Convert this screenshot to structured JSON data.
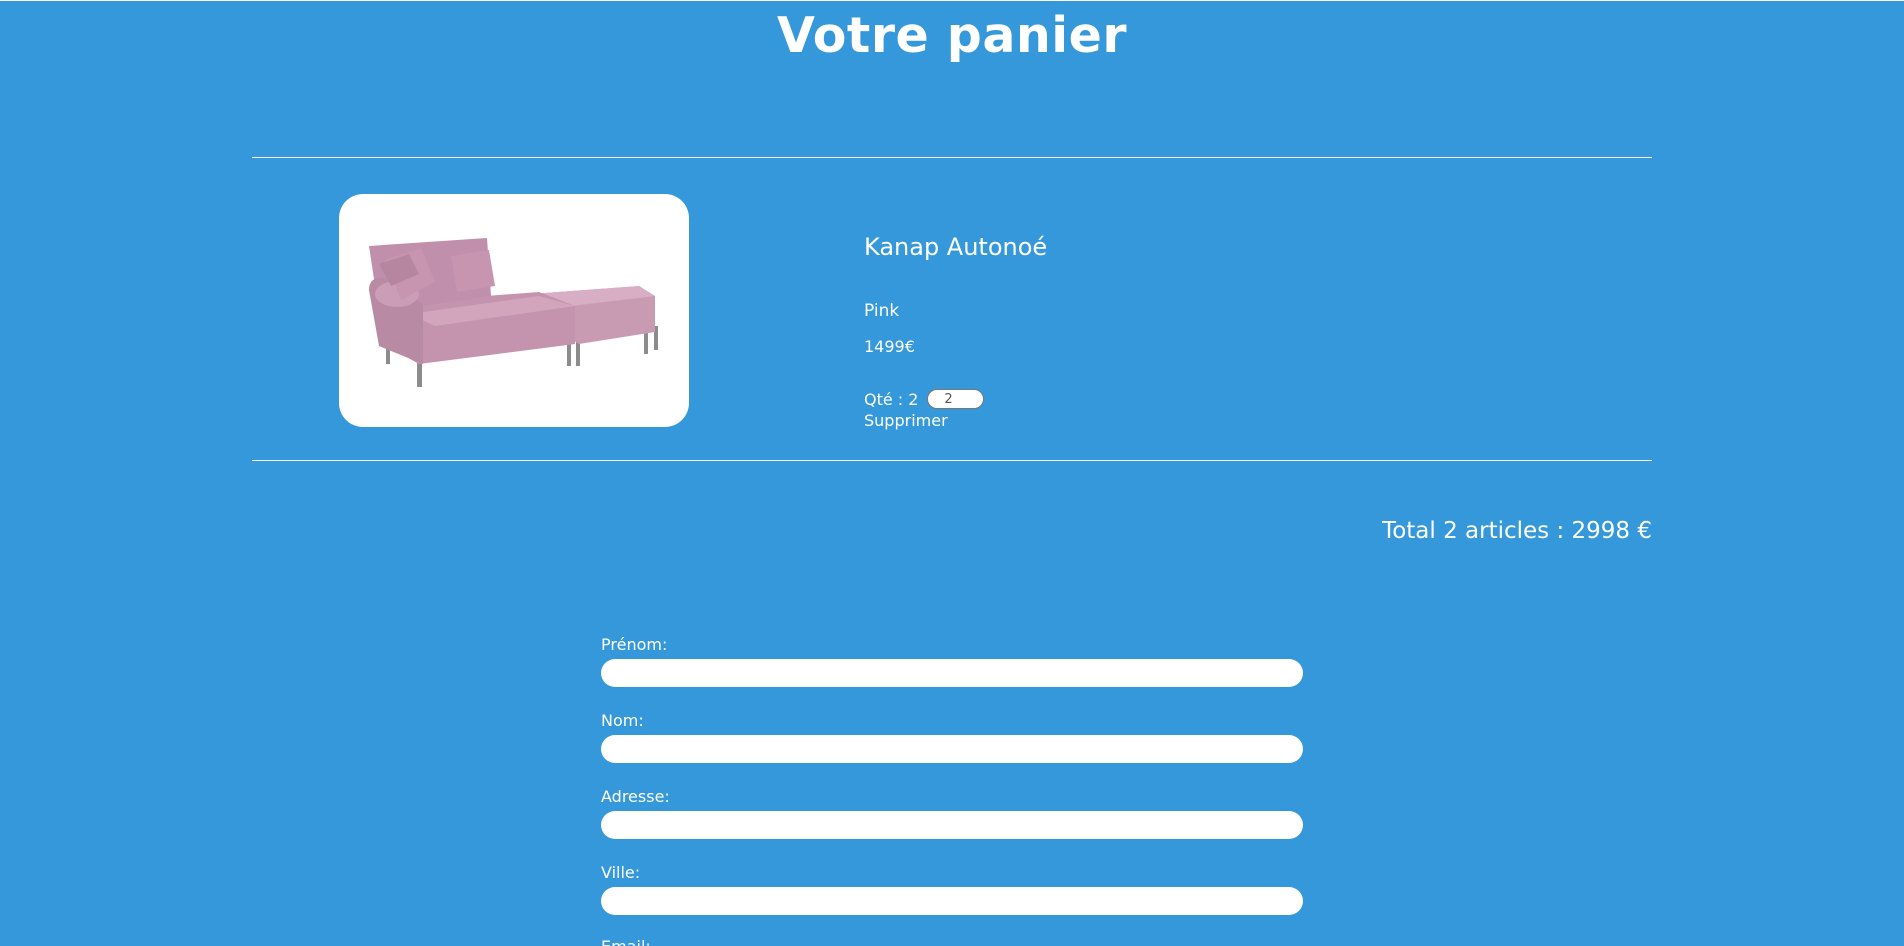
{
  "page": {
    "title": "Votre panier",
    "background_color": "#3498db"
  },
  "cart": {
    "items": [
      {
        "image_icon": "pink-sofa-image",
        "name": "Kanap Autonoé",
        "color": "Pink",
        "price": "1499€",
        "quantity_label": "Qté : 2",
        "quantity_value": "2",
        "delete_label": "Supprimer"
      }
    ],
    "total_label": "Total 2 articles : 2998 €"
  },
  "form": {
    "first_name_label": "Prénom:",
    "last_name_label": "Nom:",
    "address_label": "Adresse:",
    "city_label": "Ville:",
    "email_label": "Email:"
  }
}
